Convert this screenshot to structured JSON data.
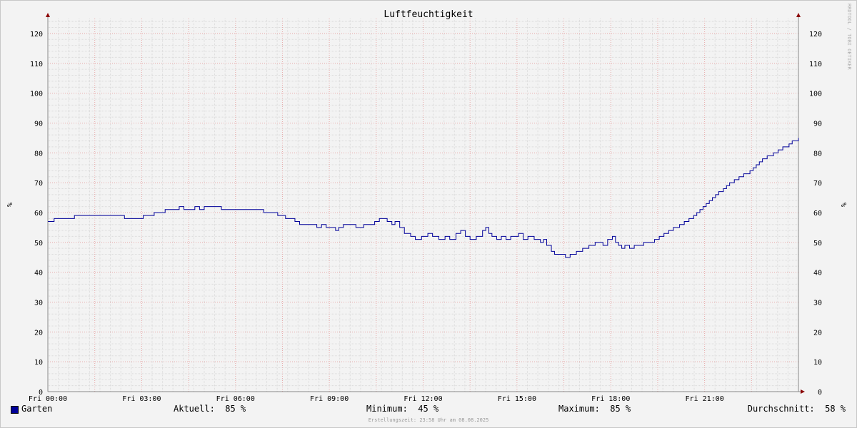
{
  "chart_data": {
    "type": "line",
    "title": "Luftfeuchtigkeit",
    "ylabel": "%",
    "ylabel_right": "%",
    "watermark": "RRDTOOL / TOBI OETIKER",
    "ylim": [
      0,
      125
    ],
    "yticks": [
      0,
      10,
      20,
      30,
      40,
      50,
      60,
      70,
      80,
      90,
      100,
      110,
      120
    ],
    "xlim_hours": [
      0,
      24
    ],
    "xticks": [
      {
        "h": 0,
        "label": "Fri 00:00"
      },
      {
        "h": 3,
        "label": "Fri 03:00"
      },
      {
        "h": 6,
        "label": "Fri 06:00"
      },
      {
        "h": 9,
        "label": "Fri 09:00"
      },
      {
        "h": 12,
        "label": "Fri 12:00"
      },
      {
        "h": 15,
        "label": "Fri 15:00"
      },
      {
        "h": 18,
        "label": "Fri 18:00"
      },
      {
        "h": 21,
        "label": "Fri 21:00"
      }
    ],
    "grid": true,
    "legend_position": "bottom-left",
    "series": [
      {
        "name": "Garten",
        "color": "#000099",
        "points": [
          [
            0,
            57
          ],
          [
            0.2,
            58
          ],
          [
            0.85,
            59
          ],
          [
            2.45,
            58
          ],
          [
            3.05,
            59
          ],
          [
            3.4,
            60
          ],
          [
            3.75,
            61
          ],
          [
            4.2,
            62
          ],
          [
            4.35,
            61
          ],
          [
            4.7,
            62
          ],
          [
            4.85,
            61
          ],
          [
            5.0,
            62
          ],
          [
            5.55,
            61
          ],
          [
            6.9,
            60
          ],
          [
            7.35,
            59
          ],
          [
            7.6,
            58
          ],
          [
            7.9,
            57
          ],
          [
            8.05,
            56
          ],
          [
            8.6,
            55
          ],
          [
            8.75,
            56
          ],
          [
            8.9,
            55
          ],
          [
            9.2,
            54
          ],
          [
            9.3,
            55
          ],
          [
            9.45,
            56
          ],
          [
            9.85,
            55
          ],
          [
            10.1,
            56
          ],
          [
            10.45,
            57
          ],
          [
            10.6,
            58
          ],
          [
            10.85,
            57
          ],
          [
            11.0,
            56
          ],
          [
            11.1,
            57
          ],
          [
            11.25,
            55
          ],
          [
            11.4,
            53
          ],
          [
            11.6,
            52
          ],
          [
            11.75,
            51
          ],
          [
            11.95,
            52
          ],
          [
            12.15,
            53
          ],
          [
            12.3,
            52
          ],
          [
            12.5,
            51
          ],
          [
            12.7,
            52
          ],
          [
            12.85,
            51
          ],
          [
            13.05,
            53
          ],
          [
            13.2,
            54
          ],
          [
            13.35,
            52
          ],
          [
            13.5,
            51
          ],
          [
            13.7,
            52
          ],
          [
            13.9,
            54
          ],
          [
            14.0,
            55
          ],
          [
            14.1,
            53
          ],
          [
            14.2,
            52
          ],
          [
            14.35,
            51
          ],
          [
            14.5,
            52
          ],
          [
            14.65,
            51
          ],
          [
            14.8,
            52
          ],
          [
            15.05,
            53
          ],
          [
            15.2,
            51
          ],
          [
            15.35,
            52
          ],
          [
            15.55,
            51
          ],
          [
            15.75,
            50
          ],
          [
            15.85,
            51
          ],
          [
            15.95,
            49
          ],
          [
            16.1,
            47
          ],
          [
            16.2,
            46
          ],
          [
            16.45,
            46
          ],
          [
            16.55,
            45
          ],
          [
            16.7,
            46
          ],
          [
            16.9,
            47
          ],
          [
            17.1,
            48
          ],
          [
            17.3,
            49
          ],
          [
            17.5,
            50
          ],
          [
            17.75,
            49
          ],
          [
            17.9,
            51
          ],
          [
            18.05,
            52
          ],
          [
            18.15,
            50
          ],
          [
            18.25,
            49
          ],
          [
            18.35,
            48
          ],
          [
            18.45,
            49
          ],
          [
            18.6,
            48
          ],
          [
            18.75,
            49
          ],
          [
            19.05,
            50
          ],
          [
            19.4,
            51
          ],
          [
            19.55,
            52
          ],
          [
            19.7,
            53
          ],
          [
            19.85,
            54
          ],
          [
            20.0,
            55
          ],
          [
            20.2,
            56
          ],
          [
            20.35,
            57
          ],
          [
            20.5,
            58
          ],
          [
            20.65,
            59
          ],
          [
            20.75,
            60
          ],
          [
            20.85,
            61
          ],
          [
            20.95,
            62
          ],
          [
            21.05,
            63
          ],
          [
            21.15,
            64
          ],
          [
            21.25,
            65
          ],
          [
            21.35,
            66
          ],
          [
            21.45,
            67
          ],
          [
            21.6,
            68
          ],
          [
            21.7,
            69
          ],
          [
            21.8,
            70
          ],
          [
            21.95,
            71
          ],
          [
            22.1,
            72
          ],
          [
            22.25,
            73
          ],
          [
            22.45,
            74
          ],
          [
            22.55,
            75
          ],
          [
            22.65,
            76
          ],
          [
            22.75,
            77
          ],
          [
            22.85,
            78
          ],
          [
            23.0,
            79
          ],
          [
            23.2,
            80
          ],
          [
            23.35,
            81
          ],
          [
            23.5,
            82
          ],
          [
            23.7,
            83
          ],
          [
            23.8,
            84
          ],
          [
            24.0,
            85
          ]
        ]
      }
    ]
  },
  "legend": {
    "series_name": "Garten",
    "current": "Aktuell:  85 %",
    "minimum": "Minimum:  45 %",
    "maximum": "Maximum:  85 %",
    "average": "Durchschnitt:  58 %"
  },
  "footer": "Erstellungszeit: 23:58 Uhr am 08.08.2025"
}
